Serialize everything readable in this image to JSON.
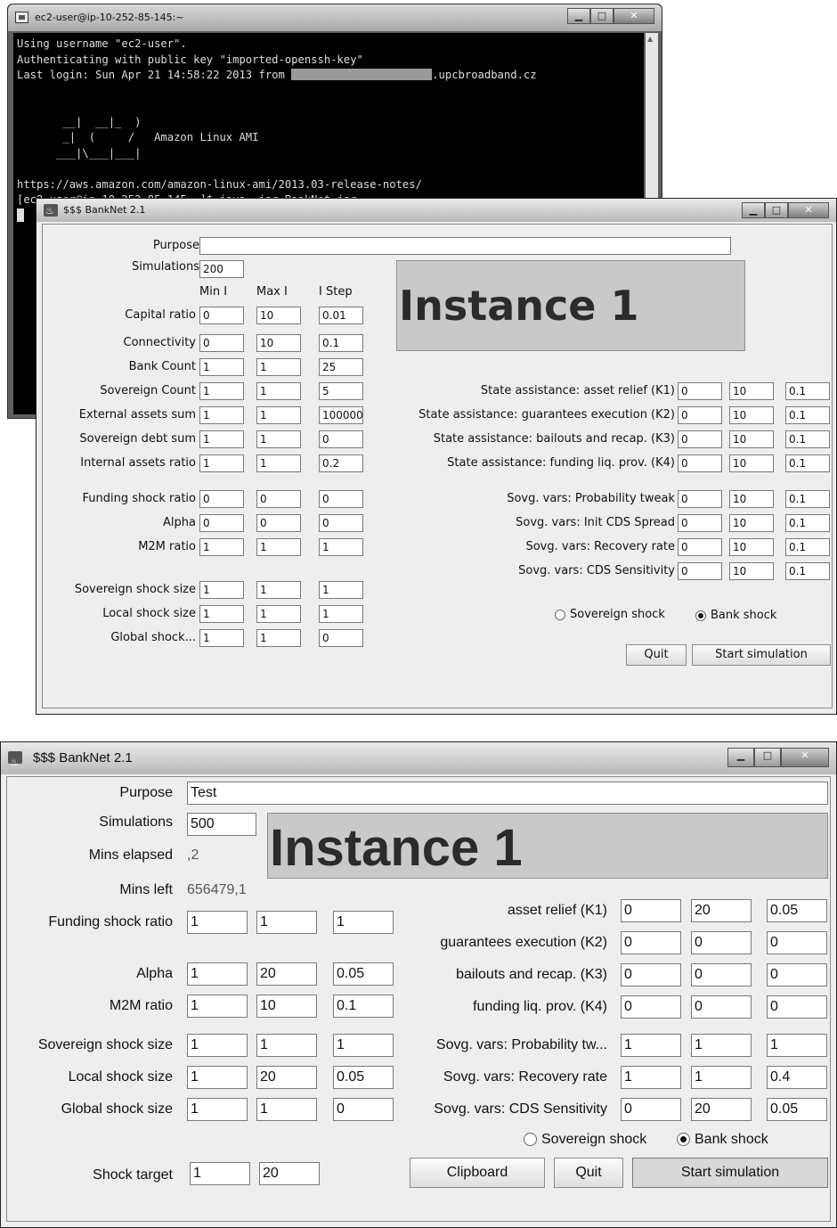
{
  "terminal": {
    "title": "ec2-user@ip-10-252-85-145:~",
    "lines": {
      "l1": "Using username \"ec2-user\".",
      "l2": "Authenticating with public key \"imported-openssh-key\"",
      "l3": "Last login: Sun Apr 21 14:58:22 2013 from",
      "l3b": ".upcbroadband.cz",
      "l4": "       __|  __|_  )",
      "l5": "       _|  (     /   Amazon Linux AMI",
      "l6": "      ___|\\___|___|",
      "l7": "https://aws.amazon.com/amazon-linux-ami/2013.03-release-notes/",
      "l8": "[ec2-user@ip-10-252-85-145 ~]$ java -jar BankNet.jar"
    }
  },
  "w1": {
    "title": "$$$ BankNet 2.1",
    "banner": "Instance 1",
    "purpose_label": "Purpose",
    "purpose_value": "",
    "simulations_label": "Simulations",
    "simulations_value": "200",
    "headers": [
      "Min I",
      "Max I",
      "I Step"
    ],
    "left_rows": [
      {
        "label": "Capital ratio",
        "min": "0",
        "max": "10",
        "step": "0.01"
      },
      {
        "label": "Connectivity",
        "min": "0",
        "max": "10",
        "step": "0.1"
      },
      {
        "label": "Bank Count",
        "min": "1",
        "max": "1",
        "step": "25"
      },
      {
        "label": "Sovereign Count",
        "min": "1",
        "max": "1",
        "step": "5"
      },
      {
        "label": "External assets sum",
        "min": "1",
        "max": "1",
        "step": "100000"
      },
      {
        "label": "Sovereign debt sum",
        "min": "1",
        "max": "1",
        "step": "0"
      },
      {
        "label": "Internal assets ratio",
        "min": "1",
        "max": "1",
        "step": "0.2"
      },
      {
        "label": "Funding shock ratio",
        "min": "0",
        "max": "0",
        "step": "0"
      },
      {
        "label": "Alpha",
        "min": "0",
        "max": "0",
        "step": "0"
      },
      {
        "label": "M2M ratio",
        "min": "1",
        "max": "1",
        "step": "1"
      },
      {
        "label": "Sovereign shock size",
        "min": "1",
        "max": "1",
        "step": "1"
      },
      {
        "label": "Local shock size",
        "min": "1",
        "max": "1",
        "step": "1"
      },
      {
        "label": "Global shock...",
        "min": "1",
        "max": "1",
        "step": "0"
      }
    ],
    "right_rows": [
      {
        "label": "State assistance: asset relief (K1)",
        "min": "0",
        "max": "10",
        "step": "0.1"
      },
      {
        "label": "State assistance: guarantees execution (K2)",
        "min": "0",
        "max": "10",
        "step": "0.1"
      },
      {
        "label": "State assistance: bailouts and recap. (K3)",
        "min": "0",
        "max": "10",
        "step": "0.1"
      },
      {
        "label": "State assistance: funding liq. prov. (K4)",
        "min": "0",
        "max": "10",
        "step": "0.1"
      },
      {
        "label": "Sovg. vars: Probability tweak",
        "min": "0",
        "max": "10",
        "step": "0.1"
      },
      {
        "label": "Sovg. vars: Init CDS Spread",
        "min": "0",
        "max": "10",
        "step": "0.1"
      },
      {
        "label": "Sovg. vars: Recovery rate",
        "min": "0",
        "max": "10",
        "step": "0.1"
      },
      {
        "label": "Sovg. vars: CDS Sensitivity",
        "min": "0",
        "max": "10",
        "step": "0.1"
      }
    ],
    "radio_sovereign": "Sovereign shock",
    "radio_bank": "Bank shock",
    "quit": "Quit",
    "start": "Start simulation"
  },
  "w2": {
    "title": "$$$ BankNet 2.1",
    "banner": "Instance 1",
    "purpose_label": "Purpose",
    "purpose_value": "Test",
    "simulations_label": "Simulations",
    "simulations_value": "500",
    "mins_elapsed_label": "Mins elapsed",
    "mins_elapsed_value": ",2",
    "mins_left_label": "Mins left",
    "mins_left_value": "656479,1",
    "left_rows": [
      {
        "label": "Funding shock ratio",
        "min": "1",
        "max": "1",
        "step": "1"
      },
      {
        "label": "Alpha",
        "min": "1",
        "max": "20",
        "step": "0.05"
      },
      {
        "label": "M2M ratio",
        "min": "1",
        "max": "10",
        "step": "0.1"
      },
      {
        "label": "Sovereign shock size",
        "min": "1",
        "max": "1",
        "step": "1"
      },
      {
        "label": "Local shock size",
        "min": "1",
        "max": "20",
        "step": "0.05"
      },
      {
        "label": "Global shock size",
        "min": "1",
        "max": "1",
        "step": "0"
      }
    ],
    "right_rows": [
      {
        "label": "asset relief (K1)",
        "min": "0",
        "max": "20",
        "step": "0.05"
      },
      {
        "label": "guarantees execution (K2)",
        "min": "0",
        "max": "0",
        "step": "0"
      },
      {
        "label": "bailouts and recap. (K3)",
        "min": "0",
        "max": "0",
        "step": "0"
      },
      {
        "label": "funding liq. prov. (K4)",
        "min": "0",
        "max": "0",
        "step": "0"
      },
      {
        "label": "Sovg. vars: Probability tw...",
        "min": "1",
        "max": "1",
        "step": "1"
      },
      {
        "label": "Sovg. vars: Recovery rate",
        "min": "1",
        "max": "1",
        "step": "0.4"
      },
      {
        "label": "Sovg. vars: CDS Sensitivity",
        "min": "0",
        "max": "20",
        "step": "0.05"
      }
    ],
    "shock_target_label": "Shock target",
    "shock_target_min": "1",
    "shock_target_max": "20",
    "radio_sovereign": "Sovereign shock",
    "radio_bank": "Bank shock",
    "clipboard": "Clipboard",
    "quit": "Quit",
    "start": "Start simulation"
  }
}
